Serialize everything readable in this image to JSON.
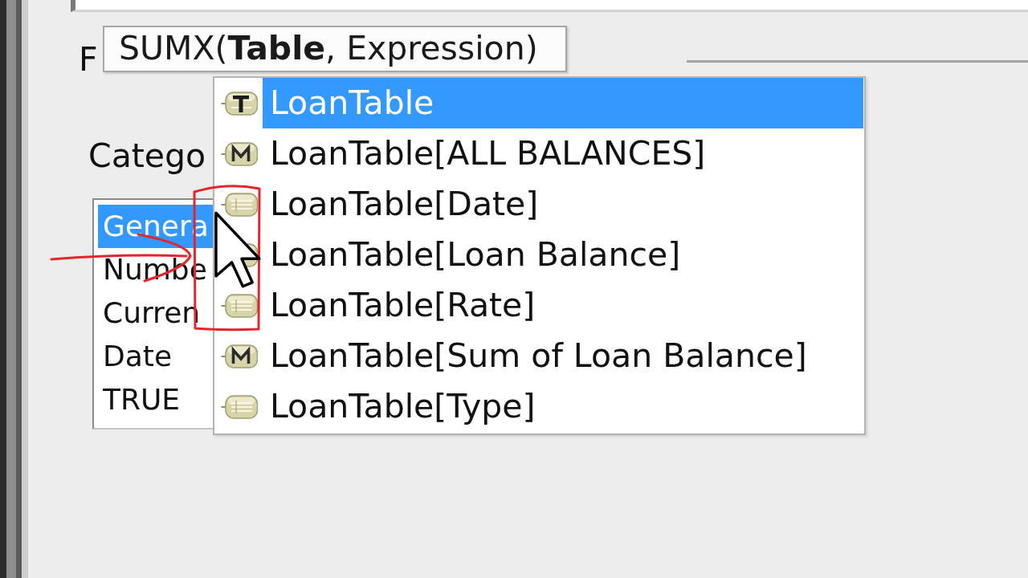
{
  "formula_bar": {
    "label": "F"
  },
  "function_tooltip": {
    "signature": "SUMX(**Table**, Expression)"
  },
  "autocomplete": {
    "items": [
      {
        "label": "LoanTable",
        "kind": "table",
        "selected": true
      },
      {
        "label": "LoanTable[ALL BALANCES]",
        "kind": "measure",
        "selected": false
      },
      {
        "label": "LoanTable[Date]",
        "kind": "column",
        "selected": false
      },
      {
        "label": "LoanTable[Loan Balance]",
        "kind": "column",
        "selected": false
      },
      {
        "label": "LoanTable[Rate]",
        "kind": "column",
        "selected": false
      },
      {
        "label": "LoanTable[Sum of Loan Balance]",
        "kind": "measure",
        "selected": false
      },
      {
        "label": "LoanTable[Type]",
        "kind": "column",
        "selected": false
      }
    ]
  },
  "category": {
    "label": "Catego",
    "items": [
      {
        "label": "Genera",
        "selected": true
      },
      {
        "label": "Numbe",
        "selected": false
      },
      {
        "label": "Curren",
        "selected": false
      },
      {
        "label": "Date",
        "selected": false
      },
      {
        "label": "TRUE",
        "selected": false
      }
    ]
  }
}
